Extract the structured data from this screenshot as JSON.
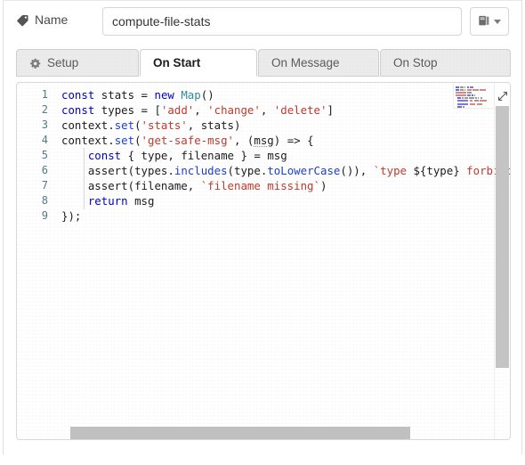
{
  "form": {
    "name_label": "Name",
    "name_icon": "tag-icon",
    "name_value": "compute-file-stats",
    "name_placeholder": "Name",
    "library_button_icon": "book-icon",
    "library_caret_icon": "chevron-down-icon"
  },
  "tabs": [
    {
      "id": "setup",
      "label": "Setup",
      "icon": "gear-icon",
      "active": false
    },
    {
      "id": "on-start",
      "label": "On Start",
      "icon": "",
      "active": true
    },
    {
      "id": "on-message",
      "label": "On Message",
      "icon": "",
      "active": false
    },
    {
      "id": "on-stop",
      "label": "On Stop",
      "icon": "",
      "active": false
    }
  ],
  "editor": {
    "line_numbers": [
      "1",
      "2",
      "3",
      "4",
      "5",
      "6",
      "7",
      "8",
      "9"
    ],
    "lines": [
      "const stats = new Map()",
      "const types = ['add', 'change', 'delete']",
      "context.set('stats', stats)",
      "context.set('get-safe-msg', (msg) => {",
      "    const { type, filename } = msg",
      "    assert(types.includes(type.toLowerCase()), `type ${type} forbidden`)",
      "    assert(filename, `filename missing`)",
      "    return msg",
      "});"
    ],
    "minimap_icon": "minimap",
    "expand_icon": "expand-diagonal-icon",
    "vertical_scrollbar": "vertical-scrollbar",
    "horizontal_scrollbar": "horizontal-scrollbar"
  },
  "colors": {
    "keyword": "#0000cd",
    "string": "#c0392b",
    "type": "#2e8b93",
    "function": "#1a3fd6",
    "line_number": "#4f7d84",
    "tab_active_bg": "#ffffff",
    "tab_inactive_bg": "#ebebeb",
    "border": "#d6d6d6",
    "scrollbar": "#c4c4c4"
  }
}
